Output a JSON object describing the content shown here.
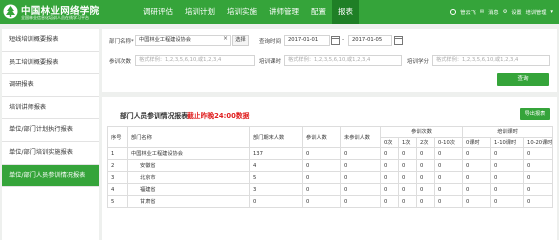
{
  "header": {
    "logo_title": "中国林业网络学院",
    "logo_sub": "全国林业信息化培训人员在线学习平台",
    "nav": [
      "调研评估",
      "培训计划",
      "培训实施",
      "讲师管理",
      "配置",
      "报表"
    ],
    "active_nav": "报表",
    "user": "管云飞",
    "message": "消息",
    "settings": "设置",
    "dropdown": "培训管理"
  },
  "sidebar": {
    "items": [
      "短线培训概要报表",
      "员工培训概要报表",
      "调研报表",
      "培训讲师报表",
      "单位/部门计划执行报表",
      "单位/部门培训实施报表",
      "单位/部门人员参训情况报表"
    ],
    "active_index": 6
  },
  "filter": {
    "dept_label": "部门名称*",
    "dept_value": "中国林业工程建设协会",
    "clear_icon": "×",
    "select_label": "选择",
    "time_label": "查询时间",
    "date_start": "2017-01-01",
    "date_sep": "-",
    "date_end": "2017-01-05",
    "count_label": "参训次数",
    "count_placeholder": "格式样例：1,2,3,5,6,10,或1,2,3,4",
    "hours_label": "培训课时",
    "hours_placeholder": "格式样例：1,2,3,5,6,10,或1,2,3,4",
    "credits_label": "培训学分",
    "credits_placeholder": "格式样例：1,2,3,5,6,10,或1,2,3,4",
    "query_label": "查询"
  },
  "report": {
    "title": "部门人员参训情况报表",
    "deadline": "截止昨晚24:00数据",
    "export_label": "导出报表",
    "headers": {
      "no": "序号",
      "dept": "部门名称",
      "total": "部门期末人数",
      "trained": "参训人数",
      "untrained": "未参训人数",
      "count_group": "参训次数",
      "count_cols": [
        "0次",
        "1次",
        "2次",
        "0-10次"
      ],
      "hours_group": "培训课时",
      "hours_cols": [
        "0课时",
        "1-10课时",
        "10-20课时"
      ]
    },
    "rows": [
      {
        "no": "1",
        "dept": "中国林业工程建设协会",
        "indent": false,
        "values": [
          "137",
          "0",
          "0",
          "0",
          "0",
          "0",
          "0",
          "0",
          "0",
          "0"
        ]
      },
      {
        "no": "2",
        "dept": "安徽省",
        "indent": true,
        "values": [
          "4",
          "0",
          "0",
          "0",
          "0",
          "0",
          "0",
          "0",
          "0",
          "0"
        ]
      },
      {
        "no": "3",
        "dept": "北京市",
        "indent": true,
        "values": [
          "5",
          "0",
          "0",
          "0",
          "0",
          "0",
          "0",
          "0",
          "0",
          "0"
        ]
      },
      {
        "no": "4",
        "dept": "福建省",
        "indent": true,
        "values": [
          "3",
          "0",
          "0",
          "0",
          "0",
          "0",
          "0",
          "0",
          "0",
          "0"
        ]
      },
      {
        "no": "5",
        "dept": "甘肃省",
        "indent": true,
        "values": [
          "0",
          "0",
          "0",
          "0",
          "0",
          "0",
          "0",
          "0",
          "0",
          "0"
        ]
      }
    ]
  },
  "colors": {
    "brand": "#35a43a",
    "brand_dark": "#1f7f26",
    "alert": "#e02020"
  }
}
